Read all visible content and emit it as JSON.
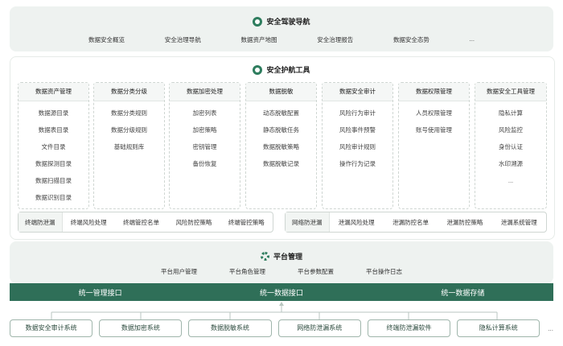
{
  "navigation": {
    "title": "安全驾驶导航",
    "links": [
      "数据安全概览",
      "安全治理导航",
      "数据资产地图",
      "安全治理报告",
      "数据安全态势",
      "..."
    ]
  },
  "tools": {
    "title": "安全护航工具",
    "columns": [
      {
        "title": "数据资产管理",
        "items": [
          "数据源目录",
          "数据表目录",
          "文件目录",
          "数据探测目录",
          "数据扫描目录",
          "数据识别目录"
        ]
      },
      {
        "title": "数据分类分级",
        "items": [
          "数据分类规则",
          "数据分级规则",
          "基础规则库"
        ]
      },
      {
        "title": "数据加密处理",
        "items": [
          "加密列表",
          "加密策略",
          "密钥管理",
          "备份恢复"
        ]
      },
      {
        "title": "数据脱敏",
        "items": [
          "动态脱敏配置",
          "静态脱敏任务",
          "数据脱敏策略",
          "数据脱敏记录"
        ]
      },
      {
        "title": "数据安全审计",
        "items": [
          "风险行为审计",
          "风险事件预警",
          "风险审计规则",
          "操作行为记录"
        ]
      },
      {
        "title": "数据权限管理",
        "items": [
          "人员权限管理",
          "账号使用管理"
        ]
      },
      {
        "title": "数据安全工具管理",
        "items": [
          "隐私计算",
          "风险监控",
          "身份认证",
          "水印溯源",
          "..."
        ]
      }
    ],
    "terminal_leak": {
      "title": "终端防泄漏",
      "items": [
        "终端风险处理",
        "终端管控名单",
        "风险防控策略",
        "终端管控策略"
      ]
    },
    "network_leak": {
      "title": "网络防泄漏",
      "items": [
        "泄漏风险处理",
        "泄漏防控名单",
        "泄漏防控策略",
        "泄漏系统管理"
      ]
    }
  },
  "platform": {
    "title": "平台管理",
    "links": [
      "平台用户管理",
      "平台角色管理",
      "平台参数配置",
      "平台操作日志"
    ]
  },
  "interfaces": [
    "统一管理接口",
    "统一数据接口",
    "统一数据存储"
  ],
  "systems": [
    "数据安全审计系统",
    "数据加密系统",
    "数据脱敏系统",
    "网络防泄漏系统",
    "终端防泄漏软件",
    "隐私计算系统",
    "..."
  ],
  "colors": {
    "accent": "#2f6f58",
    "band": "#eef2f0"
  }
}
